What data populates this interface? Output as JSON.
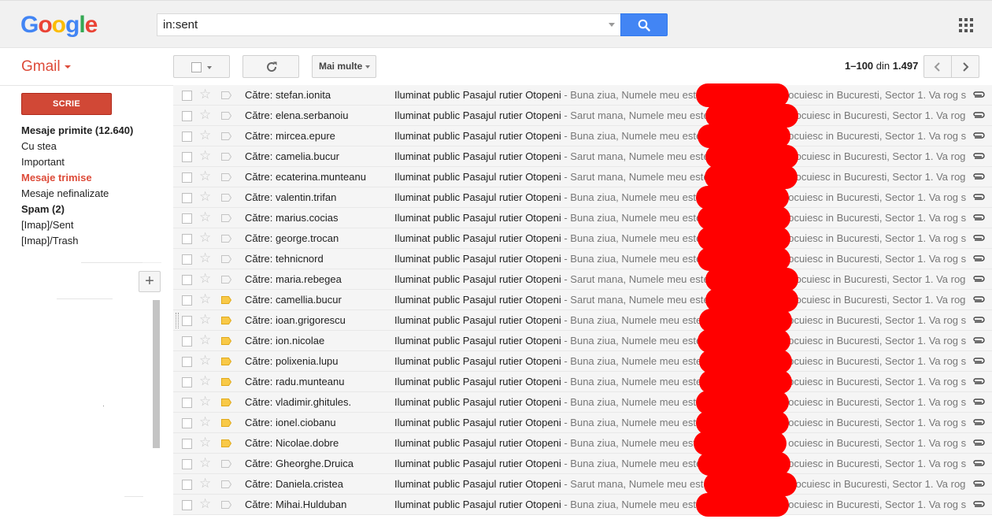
{
  "header": {
    "logo": [
      "G",
      "o",
      "o",
      "g",
      "l",
      "e"
    ],
    "logo_colors": [
      "#4285f4",
      "#ea4335",
      "#fbbc05",
      "#4285f4",
      "#34a853",
      "#ea4335"
    ],
    "search_value": "in:sent"
  },
  "toolbar": {
    "gmail_label": "Gmail",
    "more_label": "Mai multe",
    "pager_range": "1–100",
    "pager_of": "din",
    "pager_total": "1.497"
  },
  "sidebar": {
    "compose_label": "SCRIE",
    "items": [
      {
        "label": "Mesaje primite (12.640)",
        "style": "bold"
      },
      {
        "label": "Cu stea",
        "style": "normal"
      },
      {
        "label": "Important",
        "style": "normal"
      },
      {
        "label": "Mesaje trimise",
        "style": "active"
      },
      {
        "label": "Mesaje nefinalizate",
        "style": "normal"
      },
      {
        "label": "Spam (2)",
        "style": "bold"
      },
      {
        "label": "[Imap]/Sent",
        "style": "normal"
      },
      {
        "label": "[Imap]/Trash",
        "style": "normal"
      }
    ],
    "add_label": "+"
  },
  "colors": {
    "accent": "#dd4b39",
    "compose_bg": "#d14836",
    "search_button": "#4285f4",
    "important_marker": "#f8c948",
    "redaction": "#ff0000"
  },
  "emails": [
    {
      "to": "Către: stefan.ionita",
      "subject": "Iluminat public Pasajul rutier Otopeni",
      "snippet": " - Buna ziua, Numele meu este",
      "snippet_tail": "ocuiesc in Bucuresti, Sector 1. Va rog s",
      "important": false
    },
    {
      "to": "Către: elena.serbanoiu",
      "subject": "Iluminat public Pasajul rutier Otopeni",
      "snippet": " - Sarut mana, Numele meu este",
      "snippet_tail": "ocuiesc in Bucuresti, Sector 1. Va rog",
      "important": false
    },
    {
      "to": "Către: mircea.epure",
      "subject": "Iluminat public Pasajul rutier Otopeni",
      "snippet": " - Buna ziua, Numele meu este",
      "snippet_tail": "ocuiesc in Bucuresti, Sector 1. Va rog s",
      "important": false
    },
    {
      "to": "Către: camelia.bucur",
      "subject": "Iluminat public Pasajul rutier Otopeni",
      "snippet": " - Sarut mana, Numele meu este",
      "snippet_tail": "ocuiesc in Bucuresti, Sector 1. Va rog",
      "important": false
    },
    {
      "to": "Către: ecaterina.munteanu",
      "subject": "Iluminat public Pasajul rutier Otopeni",
      "snippet": " - Sarut mana, Numele meu este",
      "snippet_tail": "ocuiesc in Bucuresti, Sector 1. Va rog",
      "important": false
    },
    {
      "to": "Către: valentin.trifan",
      "subject": "Iluminat public Pasajul rutier Otopeni",
      "snippet": " - Buna ziua, Numele meu este",
      "snippet_tail": "ocuiesc in Bucuresti, Sector 1. Va rog s",
      "important": false
    },
    {
      "to": "Către: marius.cocias",
      "subject": "Iluminat public Pasajul rutier Otopeni",
      "snippet": " - Buna ziua, Numele meu este",
      "snippet_tail": "ocuiesc in Bucuresti, Sector 1. Va rog s",
      "important": false
    },
    {
      "to": "Către: george.trocan",
      "subject": "Iluminat public Pasajul rutier Otopeni",
      "snippet": " - Buna ziua, Numele meu este",
      "snippet_tail": "ocuiesc in Bucuresti, Sector 1. Va rog s",
      "important": false
    },
    {
      "to": "Către: tehnicnord",
      "subject": "Iluminat public Pasajul rutier Otopeni",
      "snippet": " - Buna ziua, Numele meu este",
      "snippet_tail": "ocuiesc in Bucuresti, Sector 1. Va rog s",
      "important": false
    },
    {
      "to": "Către: maria.rebegea",
      "subject": "Iluminat public Pasajul rutier Otopeni",
      "snippet": " - Sarut mana, Numele meu este",
      "snippet_tail": "ocuiesc in Bucuresti, Sector 1. Va rog",
      "important": false
    },
    {
      "to": "Către: camellia.bucur",
      "subject": "Iluminat public Pasajul rutier Otopeni",
      "snippet": " - Sarut mana, Numele meu este",
      "snippet_tail": "ocuiesc in Bucuresti, Sector 1. Va rog",
      "important": true
    },
    {
      "to": "Către: ioan.grigorescu",
      "subject": "Iluminat public Pasajul rutier Otopeni",
      "snippet": " - Buna ziua, Numele meu este",
      "snippet_tail": "ocuiesc in Bucuresti, Sector 1. Va rog s",
      "important": true
    },
    {
      "to": "Către: ion.nicolae",
      "subject": "Iluminat public Pasajul rutier Otopeni",
      "snippet": " - Buna ziua, Numele meu este",
      "snippet_tail": "ocuiesc in Bucuresti, Sector 1. Va rog s",
      "important": true
    },
    {
      "to": "Către: polixenia.lupu",
      "subject": "Iluminat public Pasajul rutier Otopeni",
      "snippet": " - Buna ziua, Numele meu este",
      "snippet_tail": "ocuiesc in Bucuresti, Sector 1. Va rog s",
      "important": true
    },
    {
      "to": "Către: radu.munteanu",
      "subject": "Iluminat public Pasajul rutier Otopeni",
      "snippet": " - Buna ziua, Numele meu este",
      "snippet_tail": "ocuiesc in Bucuresti, Sector 1. Va rog s",
      "important": true
    },
    {
      "to": "Către: vladimir.ghitules.",
      "subject": "Iluminat public Pasajul rutier Otopeni",
      "snippet": " - Buna ziua, Numele meu este",
      "snippet_tail": "ocuiesc in Bucuresti, Sector 1. Va rog s",
      "important": true
    },
    {
      "to": "Către: ionel.ciobanu",
      "subject": "Iluminat public Pasajul rutier Otopeni",
      "snippet": " - Buna ziua, Numele meu este",
      "snippet_tail": "ocuiesc in Bucuresti, Sector 1. Va rog s",
      "important": true
    },
    {
      "to": "Către: Nicolae.dobre",
      "subject": "Iluminat public Pasajul rutier Otopeni",
      "snippet": " - Buna ziua, Numele meu este",
      "snippet_tail": "ocuiesc in Bucuresti, Sector 1. Va rog s",
      "important": true
    },
    {
      "to": "Către: Gheorghe.Druica",
      "subject": "Iluminat public Pasajul rutier Otopeni",
      "snippet": " - Buna ziua, Numele meu este",
      "snippet_tail": "ocuiesc in Bucuresti, Sector 1. Va rog s",
      "important": false
    },
    {
      "to": "Către: Daniela.cristea",
      "subject": "Iluminat public Pasajul rutier Otopeni",
      "snippet": " - Sarut mana, Numele meu este",
      "snippet_tail": "ocuiesc in Bucuresti, Sector 1. Va rog",
      "important": false
    },
    {
      "to": "Către: Mihai.Hulduban",
      "subject": "Iluminat public Pasajul rutier Otopeni",
      "snippet": " - Buna ziua, Numele meu este",
      "snippet_tail": "ocuiesc in Bucuresti, Sector 1. Va rog s",
      "important": false
    }
  ]
}
